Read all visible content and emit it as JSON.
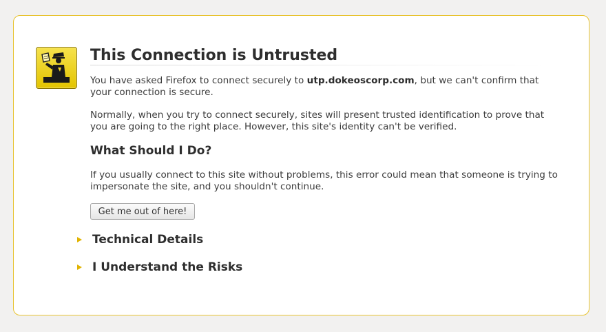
{
  "page": {
    "title": "This Connection is Untrusted",
    "intro_prefix": "You have asked Firefox to connect securely to ",
    "intro_domain": "utp.dokeoscorp.com",
    "intro_suffix": ", but we can't confirm that your connection is secure.",
    "explanation": "Normally, when you try to connect securely, sites will present trusted identification to prove that you are going to the right place. However, this site's identity can't be verified.",
    "what_to_do_heading": "What Should I Do?",
    "what_to_do_text": "If you usually connect to this site without problems, this error could mean that someone is trying to impersonate the site, and you shouldn't continue.",
    "get_out_button": "Get me out of here!",
    "expanders": [
      {
        "label": "Technical Details"
      },
      {
        "label": "I Understand the Risks"
      }
    ]
  },
  "icons": {
    "badge": "security-officer-icon",
    "expander": "triangle-right-icon"
  },
  "colors": {
    "accent": "#e8c32f",
    "badge_yellow": "#f0d52a",
    "arrow": "#e1b300",
    "background": "#f2f1f0"
  }
}
